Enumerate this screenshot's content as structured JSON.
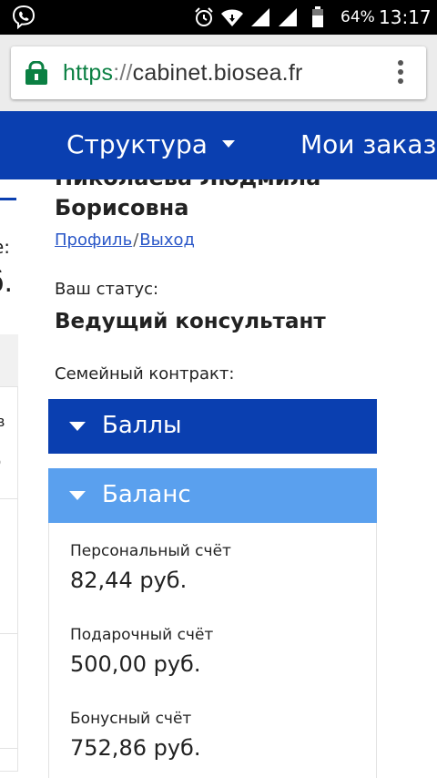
{
  "status_bar": {
    "battery_percent": "64%",
    "time": "13:17"
  },
  "browser": {
    "url_scheme": "https",
    "url_separator": "://",
    "url_host": "cabinet.biosea.fr"
  },
  "nav": {
    "items": [
      {
        "label": "Структура"
      },
      {
        "label": "Мои заказы"
      }
    ]
  },
  "left_panel": {
    "text1": "е:",
    "text2": "б.",
    "small1": "в",
    "small2": ")"
  },
  "profile": {
    "name": "Николаева Людмила Борисовна",
    "profile_link": "Профиль",
    "separator": "/",
    "logout_link": "Выход",
    "status_label": "Ваш статус:",
    "status_value": "Ведущий консультант",
    "family_contract_label": "Семейный контракт:"
  },
  "accordion": {
    "points_label": "Баллы",
    "balance_label": "Баланс"
  },
  "balance": {
    "accounts": [
      {
        "label": "Персональный счёт",
        "value": "82,44 руб."
      },
      {
        "label": "Подарочный счёт",
        "value": "500,00 руб."
      },
      {
        "label": "Бонусный счёт",
        "value": "752,86 руб."
      }
    ]
  },
  "colors": {
    "nav_blue": "#0a3fb0",
    "accordion_active": "#5aa0ee",
    "link_blue": "#2a57c8",
    "https_green": "#0b8043"
  }
}
